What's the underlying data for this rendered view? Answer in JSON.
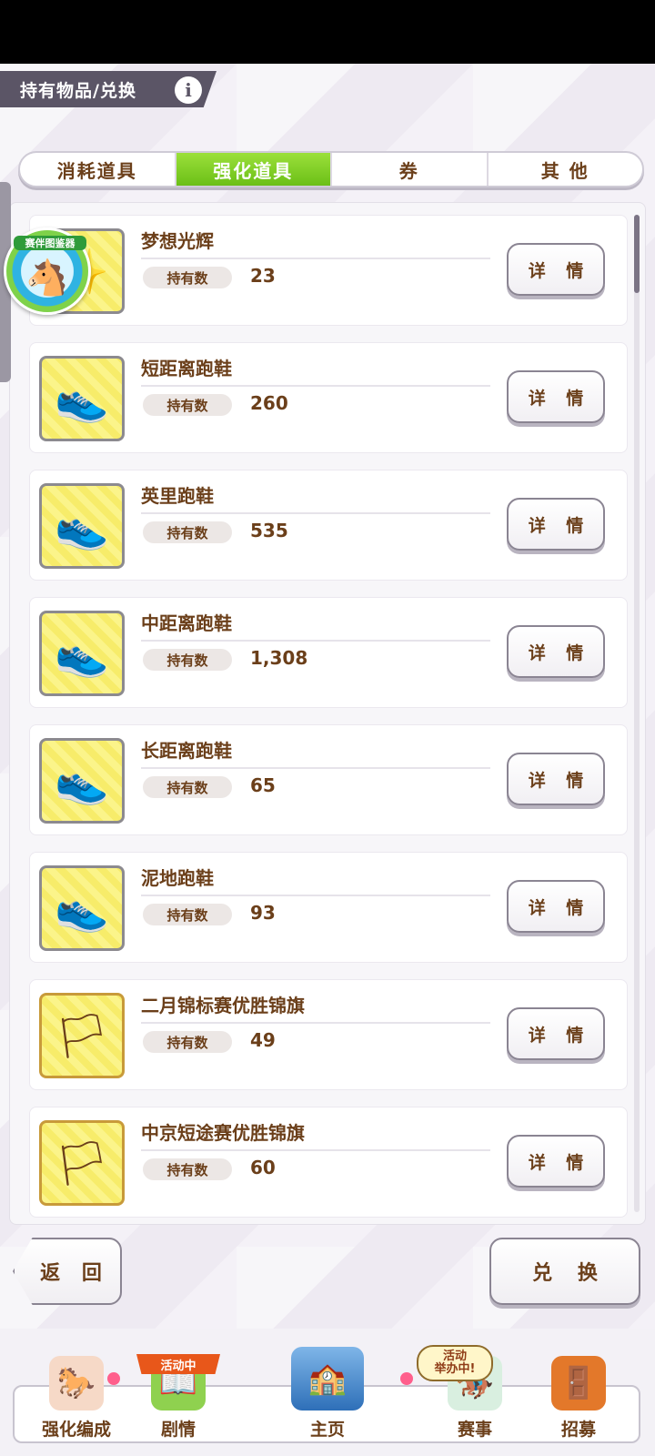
{
  "header": {
    "title": "持有物品/兑换",
    "info_icon": "i"
  },
  "tabs": [
    {
      "label": "消耗道具",
      "active": false
    },
    {
      "label": "强化道具",
      "active": true
    },
    {
      "label": "券",
      "active": false
    },
    {
      "label": "其 他",
      "active": false
    }
  ],
  "badge": {
    "label": "赛伴图鉴器"
  },
  "qty_label": "持有数",
  "detail_label": "详 情",
  "items": [
    {
      "name": "梦想光辉",
      "qty": "23",
      "icon": "dream-glow-icon",
      "emoji": "✨",
      "gold": false
    },
    {
      "name": "短距离跑鞋",
      "qty": "260",
      "icon": "pink-shoes-icon",
      "emoji": "👟",
      "gold": false
    },
    {
      "name": "英里跑鞋",
      "qty": "535",
      "icon": "green-shoes-icon",
      "emoji": "👟",
      "gold": false
    },
    {
      "name": "中距离跑鞋",
      "qty": "1,308",
      "icon": "yellow-shoes-icon",
      "emoji": "👟",
      "gold": false
    },
    {
      "name": "长距离跑鞋",
      "qty": "65",
      "icon": "blue-shoes-icon",
      "emoji": "👟",
      "gold": false
    },
    {
      "name": "泥地跑鞋",
      "qty": "93",
      "icon": "red-shoes-icon",
      "emoji": "👟",
      "gold": false
    },
    {
      "name": "二月锦标赛优胜锦旗",
      "qty": "49",
      "icon": "blue-pennant-icon",
      "emoji": "🏳",
      "gold": true
    },
    {
      "name": "中京短途赛优胜锦旗",
      "qty": "60",
      "icon": "red-pennant-icon",
      "emoji": "🏳",
      "gold": true
    }
  ],
  "buttons": {
    "back": "返 回",
    "exchange": "兑 换"
  },
  "nav": {
    "tag_event": "活动中",
    "tag_running": "活动\n举办中!",
    "items": [
      {
        "label": "强化编成",
        "icon": "character-icon"
      },
      {
        "label": "剧情",
        "icon": "story-icon"
      },
      {
        "label": "主页",
        "icon": "home-building-icon"
      },
      {
        "label": "赛事",
        "icon": "race-icon"
      },
      {
        "label": "招募",
        "icon": "gacha-icon"
      }
    ]
  },
  "colors": {
    "accent_green": "#7ccf22",
    "text_brown": "#6b3f1a",
    "header_gray": "#5b5566"
  }
}
